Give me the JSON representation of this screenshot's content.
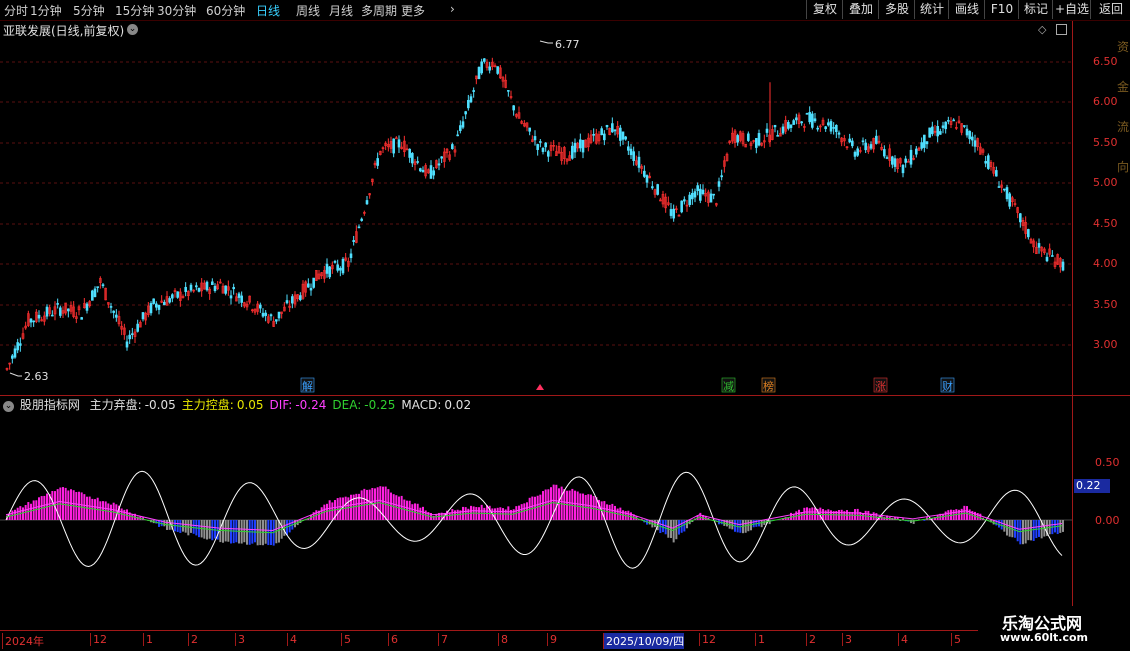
{
  "toolbar": {
    "timeframes": [
      "分时",
      "1分钟",
      "5分钟",
      "15分钟",
      "30分钟",
      "60分钟",
      "日线",
      "周线",
      "月线",
      "多周期",
      "更多"
    ],
    "active_timeframe": "日线",
    "more_chevron": "chevron-right-icon",
    "buttons": [
      "复权",
      "叠加",
      "多股",
      "统计",
      "画线",
      "F10",
      "标记",
      "+自选",
      "返回"
    ]
  },
  "main_panel": {
    "title": "亚联发展(日线,前复权)",
    "dropdown_icon": "chevron-down-icon",
    "diamond_icon": "diamond-icon",
    "box_icon": "square-icon",
    "price_labels": [
      "6.50",
      "6.00",
      "5.50",
      "5.00",
      "4.50",
      "4.00",
      "3.50",
      "3.00"
    ],
    "max_marker": "6.77",
    "min_marker": "2.63",
    "event_tags": [
      {
        "text": "解",
        "color": "#3aa0ff"
      },
      {
        "text": "减",
        "color": "#30c030"
      },
      {
        "text": "榜",
        "color": "#e08020"
      },
      {
        "text": "涨",
        "color": "#e03030"
      },
      {
        "text": "财",
        "color": "#3aa0ff"
      }
    ],
    "side_text": "资金流向"
  },
  "indicator_panel": {
    "name": "股朋指标网",
    "fields": [
      {
        "label": "主力弃盘:",
        "value": "-0.05",
        "color": "#e0e0e0"
      },
      {
        "label": "主力控盘:",
        "value": "0.05",
        "color": "#e8e800"
      },
      {
        "label": "DIF:",
        "value": "-0.24",
        "color": "#ff40ff"
      },
      {
        "label": "DEA:",
        "value": "-0.25",
        "color": "#30d030"
      },
      {
        "label": "MACD:",
        "value": "0.02",
        "color": "#e0e0e0"
      }
    ],
    "axis_labels": [
      "0.50",
      "0.00"
    ],
    "current_value": "0.22"
  },
  "date_axis": {
    "labels": [
      "2024年",
      "12",
      "1",
      "2",
      "3",
      "4",
      "5",
      "6",
      "7",
      "8",
      "9",
      "2025/10/09/四",
      "12",
      "1",
      "2",
      "3",
      "4",
      "5"
    ]
  },
  "watermark": {
    "line1": "乐淘公式网",
    "line2": "www.60lt.com"
  },
  "colors": {
    "up": "#ff3030",
    "down": "#50e0ff",
    "accent": "#38d0ff",
    "grid": "#5a1010",
    "magenta": "#ff20e0",
    "blue_bar": "#2040ff",
    "gray_bar": "#909090"
  }
}
